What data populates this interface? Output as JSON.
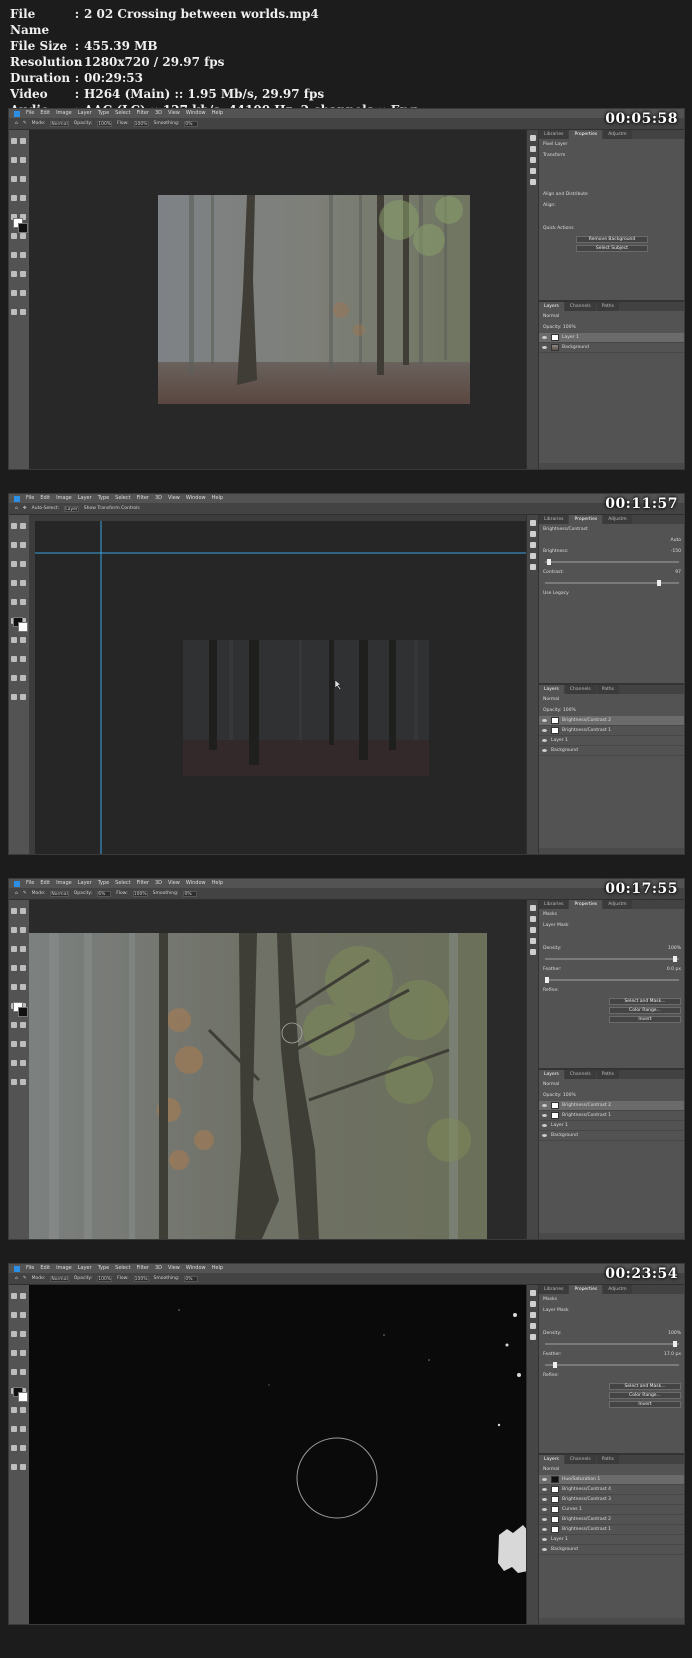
{
  "info": [
    {
      "key": "File Name",
      "sep": ":",
      "value": "2 02 Crossing between worlds.mp4"
    },
    {
      "key": "File Size",
      "sep": ":",
      "value": "455.39 MB"
    },
    {
      "key": "Resolution",
      "sep": ":",
      "value": "1280x720 / 29.97 fps"
    },
    {
      "key": "Duration",
      "sep": ":",
      "value": "00:29:53"
    },
    {
      "key": "Video",
      "sep": ":",
      "value": "H264 (Main) :: 1.95 Mb/s, 29.97 fps"
    },
    {
      "key": "Audio",
      "sep": ":",
      "value": "AAC (LC) :: 127 kb/s, 44100 Hz, 2 channels :: Eng"
    }
  ],
  "menu": [
    "File",
    "Edit",
    "Image",
    "Layer",
    "Type",
    "Select",
    "Filter",
    "3D",
    "View",
    "Window",
    "Help"
  ],
  "frames": [
    {
      "timestamp": "00:05:58",
      "options": [
        "Mode:",
        "Normal",
        "Opacity:",
        "100%",
        "Flow:",
        "100%",
        "Smoothing:",
        "0%"
      ],
      "panel_tabs": [
        "Libraries",
        "Properties",
        "Adjustm"
      ],
      "properties_title": "Pixel Layer",
      "sections": [
        "Transform",
        "Align and Distribute",
        "Align:",
        "Quick Actions"
      ],
      "buttons": [
        "Remove Background",
        "Select Subject"
      ],
      "layer_tabs": [
        "Layers",
        "Channels",
        "Paths"
      ],
      "layer_blend": "Normal",
      "layer_opacity": "Opacity: 100%",
      "layers": [
        "Layer 1",
        "Background"
      ]
    },
    {
      "timestamp": "00:11:57",
      "options": [
        "Auto-Select:",
        "Layer",
        "Show Transform Controls"
      ],
      "panel_tabs": [
        "Libraries",
        "Properties",
        "Adjustm"
      ],
      "properties_title": "Brightness/Contrast",
      "sections": [
        "Auto",
        "Brightness:",
        "Contrast:",
        "Use Legacy"
      ],
      "brightness": "-150",
      "contrast": "97",
      "layer_tabs": [
        "Layers",
        "Channels",
        "Paths"
      ],
      "layer_blend": "Normal",
      "layer_opacity": "Opacity: 100%",
      "layers": [
        "Brightness/Contrast 2",
        "Brightness/Contrast 1",
        "Layer 1",
        "Background"
      ]
    },
    {
      "timestamp": "00:17:55",
      "options": [
        "Mode:",
        "Normal",
        "Opacity:",
        "6%",
        "Flow:",
        "100%",
        "Smoothing:",
        "0%"
      ],
      "panel_tabs": [
        "Libraries",
        "Properties",
        "Adjustm"
      ],
      "properties_title": "Masks",
      "mask_label": "Layer Mask",
      "sections": [
        "Density:",
        "Feather:",
        "Refine:"
      ],
      "density": "100%",
      "feather": "0.0 px",
      "buttons": [
        "Select and Mask...",
        "Color Range...",
        "Invert"
      ],
      "layer_tabs": [
        "Layers",
        "Channels",
        "Paths"
      ],
      "layer_blend": "Normal",
      "layer_opacity": "Opacity: 100%",
      "layers": [
        "Brightness/Contrast 2",
        "Brightness/Contrast 1",
        "Layer 1",
        "Background"
      ]
    },
    {
      "timestamp": "00:23:54",
      "options": [
        "Mode:",
        "Normal",
        "Opacity:",
        "100%",
        "Flow:",
        "100%",
        "Smoothing:",
        "0%"
      ],
      "panel_tabs": [
        "Libraries",
        "Properties",
        "Adjustm"
      ],
      "properties_title": "Masks",
      "mask_label": "Layer Mask",
      "sections": [
        "Density:",
        "Feather:",
        "Refine:"
      ],
      "density": "100%",
      "feather": "17.0 px",
      "buttons": [
        "Select and Mask...",
        "Color Range...",
        "Invert"
      ],
      "layer_tabs": [
        "Layers",
        "Channels",
        "Paths"
      ],
      "layer_blend": "Normal",
      "layer_opacity": "Opacity: 100%",
      "layers": [
        "Hue/Saturation 1",
        "Brightness/Contrast 4",
        "Brightness/Contrast 3",
        "Curves 1",
        "Brightness/Contrast 2",
        "Brightness/Contrast 1",
        "Layer 1",
        "Background"
      ]
    }
  ]
}
